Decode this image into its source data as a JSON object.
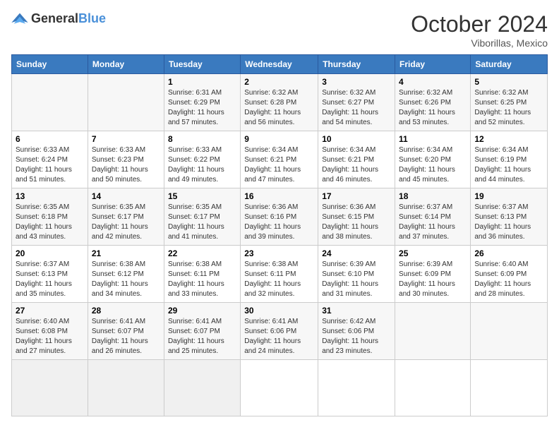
{
  "header": {
    "logo_general": "General",
    "logo_blue": "Blue",
    "month": "October 2024",
    "location": "Viborillas, Mexico"
  },
  "weekdays": [
    "Sunday",
    "Monday",
    "Tuesday",
    "Wednesday",
    "Thursday",
    "Friday",
    "Saturday"
  ],
  "days": [
    {
      "num": "",
      "info": ""
    },
    {
      "num": "",
      "info": ""
    },
    {
      "num": "1",
      "sunrise": "6:31 AM",
      "sunset": "6:29 PM",
      "daylight": "11 hours and 57 minutes."
    },
    {
      "num": "2",
      "sunrise": "6:32 AM",
      "sunset": "6:28 PM",
      "daylight": "11 hours and 56 minutes."
    },
    {
      "num": "3",
      "sunrise": "6:32 AM",
      "sunset": "6:27 PM",
      "daylight": "11 hours and 54 minutes."
    },
    {
      "num": "4",
      "sunrise": "6:32 AM",
      "sunset": "6:26 PM",
      "daylight": "11 hours and 53 minutes."
    },
    {
      "num": "5",
      "sunrise": "6:32 AM",
      "sunset": "6:25 PM",
      "daylight": "11 hours and 52 minutes."
    },
    {
      "num": "6",
      "sunrise": "6:33 AM",
      "sunset": "6:24 PM",
      "daylight": "11 hours and 51 minutes."
    },
    {
      "num": "7",
      "sunrise": "6:33 AM",
      "sunset": "6:23 PM",
      "daylight": "11 hours and 50 minutes."
    },
    {
      "num": "8",
      "sunrise": "6:33 AM",
      "sunset": "6:22 PM",
      "daylight": "11 hours and 49 minutes."
    },
    {
      "num": "9",
      "sunrise": "6:34 AM",
      "sunset": "6:21 PM",
      "daylight": "11 hours and 47 minutes."
    },
    {
      "num": "10",
      "sunrise": "6:34 AM",
      "sunset": "6:21 PM",
      "daylight": "11 hours and 46 minutes."
    },
    {
      "num": "11",
      "sunrise": "6:34 AM",
      "sunset": "6:20 PM",
      "daylight": "11 hours and 45 minutes."
    },
    {
      "num": "12",
      "sunrise": "6:34 AM",
      "sunset": "6:19 PM",
      "daylight": "11 hours and 44 minutes."
    },
    {
      "num": "13",
      "sunrise": "6:35 AM",
      "sunset": "6:18 PM",
      "daylight": "11 hours and 43 minutes."
    },
    {
      "num": "14",
      "sunrise": "6:35 AM",
      "sunset": "6:17 PM",
      "daylight": "11 hours and 42 minutes."
    },
    {
      "num": "15",
      "sunrise": "6:35 AM",
      "sunset": "6:17 PM",
      "daylight": "11 hours and 41 minutes."
    },
    {
      "num": "16",
      "sunrise": "6:36 AM",
      "sunset": "6:16 PM",
      "daylight": "11 hours and 39 minutes."
    },
    {
      "num": "17",
      "sunrise": "6:36 AM",
      "sunset": "6:15 PM",
      "daylight": "11 hours and 38 minutes."
    },
    {
      "num": "18",
      "sunrise": "6:37 AM",
      "sunset": "6:14 PM",
      "daylight": "11 hours and 37 minutes."
    },
    {
      "num": "19",
      "sunrise": "6:37 AM",
      "sunset": "6:13 PM",
      "daylight": "11 hours and 36 minutes."
    },
    {
      "num": "20",
      "sunrise": "6:37 AM",
      "sunset": "6:13 PM",
      "daylight": "11 hours and 35 minutes."
    },
    {
      "num": "21",
      "sunrise": "6:38 AM",
      "sunset": "6:12 PM",
      "daylight": "11 hours and 34 minutes."
    },
    {
      "num": "22",
      "sunrise": "6:38 AM",
      "sunset": "6:11 PM",
      "daylight": "11 hours and 33 minutes."
    },
    {
      "num": "23",
      "sunrise": "6:38 AM",
      "sunset": "6:11 PM",
      "daylight": "11 hours and 32 minutes."
    },
    {
      "num": "24",
      "sunrise": "6:39 AM",
      "sunset": "6:10 PM",
      "daylight": "11 hours and 31 minutes."
    },
    {
      "num": "25",
      "sunrise": "6:39 AM",
      "sunset": "6:09 PM",
      "daylight": "11 hours and 30 minutes."
    },
    {
      "num": "26",
      "sunrise": "6:40 AM",
      "sunset": "6:09 PM",
      "daylight": "11 hours and 28 minutes."
    },
    {
      "num": "27",
      "sunrise": "6:40 AM",
      "sunset": "6:08 PM",
      "daylight": "11 hours and 27 minutes."
    },
    {
      "num": "28",
      "sunrise": "6:41 AM",
      "sunset": "6:07 PM",
      "daylight": "11 hours and 26 minutes."
    },
    {
      "num": "29",
      "sunrise": "6:41 AM",
      "sunset": "6:07 PM",
      "daylight": "11 hours and 25 minutes."
    },
    {
      "num": "30",
      "sunrise": "6:41 AM",
      "sunset": "6:06 PM",
      "daylight": "11 hours and 24 minutes."
    },
    {
      "num": "31",
      "sunrise": "6:42 AM",
      "sunset": "6:06 PM",
      "daylight": "11 hours and 23 minutes."
    },
    {
      "num": "",
      "info": ""
    },
    {
      "num": "",
      "info": ""
    },
    {
      "num": "",
      "info": ""
    },
    {
      "num": "",
      "info": ""
    },
    {
      "num": "",
      "info": ""
    }
  ]
}
